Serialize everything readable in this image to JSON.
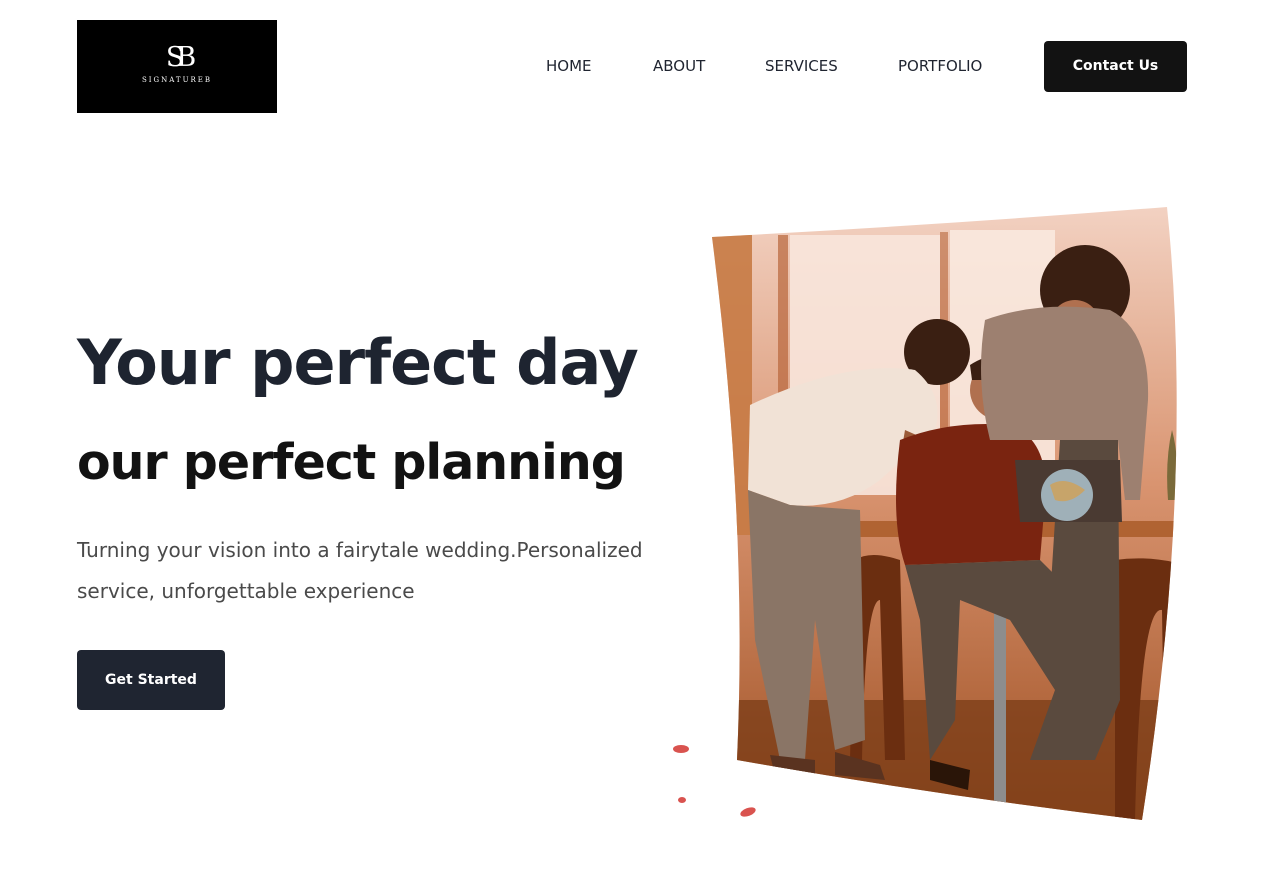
{
  "brand": {
    "monogram": "SB",
    "name": "SIGNATUREB"
  },
  "nav": {
    "items": [
      "HOME",
      "ABOUT",
      "SERVICES",
      "PORTFOLIO"
    ],
    "contact_label": "Contact Us"
  },
  "hero": {
    "title_line1": "Your perfect day",
    "title_line2": "our perfect planning",
    "subtitle": "Turning your vision into a fairytale wedding.Personalized service, unforgettable experience",
    "cta_label": "Get Started"
  },
  "colors": {
    "accent_dark": "#1f2531",
    "image_tint": "#c8652a",
    "petal": "#d9534f"
  }
}
